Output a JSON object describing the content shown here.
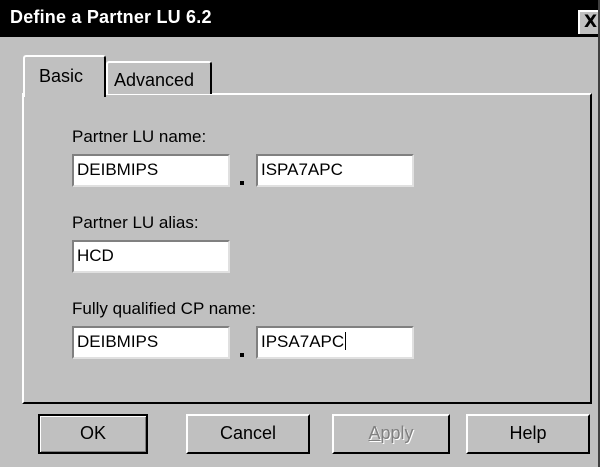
{
  "window": {
    "title": "Define a Partner LU 6.2",
    "close_glyph": "X"
  },
  "tabs": [
    {
      "label": "Basic",
      "selected": true
    },
    {
      "label": "Advanced",
      "selected": false
    }
  ],
  "form": {
    "partner_lu_name": {
      "label": "Partner LU name:",
      "network_value": "DEIBMIPS",
      "lu_value": "ISPA7APC"
    },
    "partner_lu_alias": {
      "label": "Partner LU alias:",
      "value": "HCD"
    },
    "cp_name": {
      "label": "Fully qualified CP name:",
      "network_value": "DEIBMIPS",
      "cp_value": "IPSA7APC"
    }
  },
  "buttons": {
    "ok": "OK",
    "cancel": "Cancel",
    "apply_mnemonic": "A",
    "apply_rest": "pply",
    "help": "Help"
  },
  "colors": {
    "dialog_face": "#c0c0c0",
    "title_bar": "#000000",
    "disabled_text": "#808080"
  }
}
